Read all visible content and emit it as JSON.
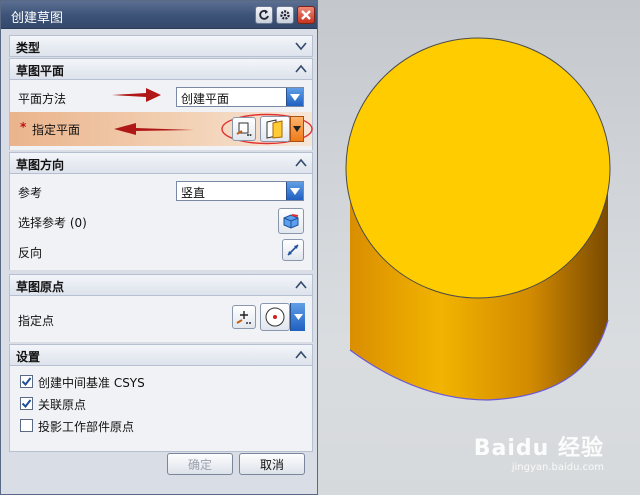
{
  "window": {
    "title": "创建草图"
  },
  "sections": {
    "type": {
      "title": "类型"
    },
    "sketch_plane": {
      "title": "草图平面",
      "plane_method_label": "平面方法",
      "plane_method_value": "创建平面",
      "specify_plane_label": "指定平面",
      "required_marker": "*"
    },
    "sketch_direction": {
      "title": "草图方向",
      "reference_label": "参考",
      "reference_value": "竖直",
      "select_reference_label": "选择参考 (0)",
      "reverse_label": "反向"
    },
    "sketch_origin": {
      "title": "草图原点",
      "specify_point_label": "指定点"
    },
    "settings": {
      "title": "设置",
      "options": [
        {
          "label": "创建中间基准 CSYS",
          "checked": true
        },
        {
          "label": "关联原点",
          "checked": true
        },
        {
          "label": "投影工作部件原点",
          "checked": false
        }
      ]
    }
  },
  "footer": {
    "ok_label": "确定",
    "cancel_label": "取消"
  },
  "watermark": {
    "brand": "Baidu 经验",
    "url": "jingyan.baidu.com"
  },
  "colors": {
    "cylinder_top": "#FFCC00",
    "cylinder_side": "#E09A00",
    "arrow": "#B01818",
    "highlight_ellipse": "#E03030"
  }
}
